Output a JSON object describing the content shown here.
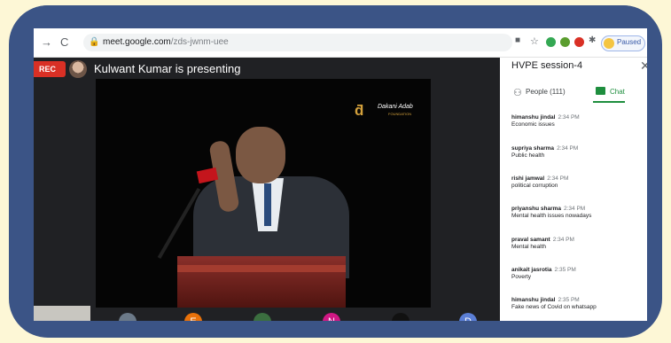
{
  "browser": {
    "url_host": "meet.google.com",
    "url_path": "/zds-jwnm-uee",
    "paused_label": "Paused",
    "back_icon": "arrow-left",
    "reload_icon": "reload"
  },
  "meeting": {
    "rec_label": "REC",
    "presenter_text": "Kulwant Kumar is presenting",
    "video_logo_text": "Dakani Adab",
    "video_logo_sub": "FOUNDATION"
  },
  "participants": [
    {
      "initial": "",
      "color": "#6c7a89"
    },
    {
      "initial": "E",
      "color": "#e8710a"
    },
    {
      "initial": "",
      "color": "#3b6e3f"
    },
    {
      "initial": "N",
      "color": "#d01884"
    },
    {
      "initial": "",
      "color": "#111111"
    },
    {
      "initial": "D",
      "color": "#5b7fd6"
    }
  ],
  "panel": {
    "title": "HVPE session-4",
    "people_label": "People (111)",
    "chat_label": "Chat"
  },
  "messages": [
    {
      "name": "himanshu jindal",
      "time": "2:34 PM",
      "text": "Economic issues"
    },
    {
      "name": "supriya sharma",
      "time": "2:34 PM",
      "text": "Public health"
    },
    {
      "name": "rishi jamwal",
      "time": "2:34 PM",
      "text": "political corruption"
    },
    {
      "name": "priyanshu sharma",
      "time": "2:34 PM",
      "text": "Mental health issues nowadays"
    },
    {
      "name": "praval samant",
      "time": "2:34 PM",
      "text": "Mental health"
    },
    {
      "name": "anikait jasrotia",
      "time": "2:35 PM",
      "text": "Poverty"
    },
    {
      "name": "himanshu jindal",
      "time": "2:35 PM",
      "text": "Fake news of Covid on whatsapp"
    }
  ]
}
